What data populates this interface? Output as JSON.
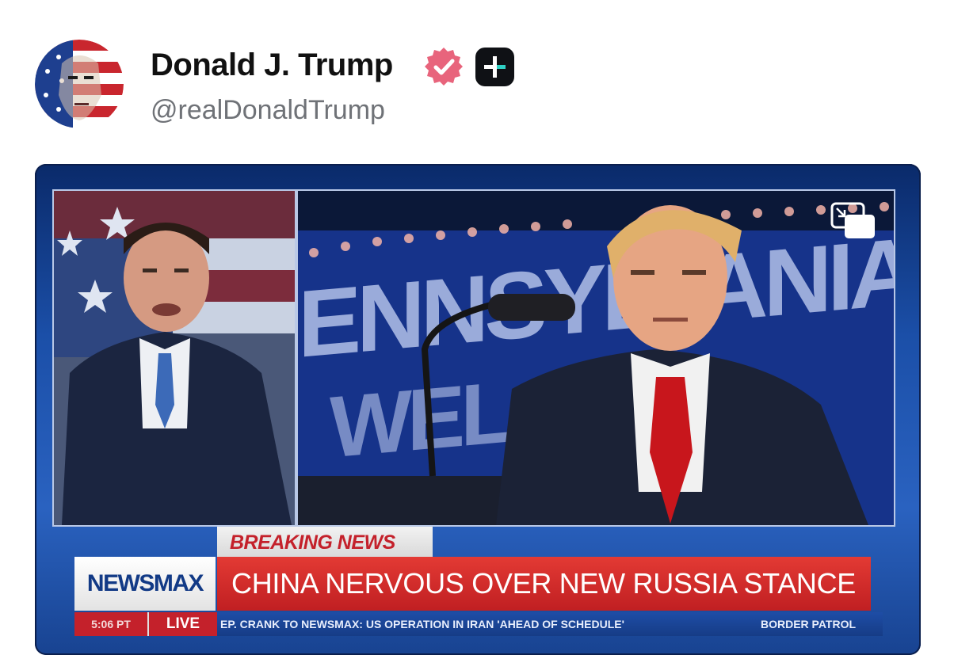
{
  "post": {
    "display_name": "Donald J. Trump",
    "handle": "@realDonaldTrump",
    "avatar_icon": "avatar-flag-portrait",
    "verified_icon": "verified-badge-icon",
    "verified_color": "#e8647c",
    "badge_icon": "plus-badge-icon"
  },
  "video": {
    "pip_icon": "picture-in-picture-icon",
    "lower_third": {
      "tag": "BREAKING NEWS",
      "network": "NEWSMAX",
      "headline": "CHINA NERVOUS OVER NEW RUSSIA STANCE",
      "time": "5:06 PT",
      "live": "LIVE",
      "ticker": "EP. CRANK TO NEWSMAX: US OPERATION IN IRAN 'AHEAD OF SCHEDULE'",
      "ticker_next": "BORDER PATROL"
    },
    "backdrop_text": "ENNSYLVANIA WELCO"
  },
  "colors": {
    "headline_red": "#c01f22",
    "network_blue": "#123a86",
    "frame_blue": "#1b4fa8"
  }
}
